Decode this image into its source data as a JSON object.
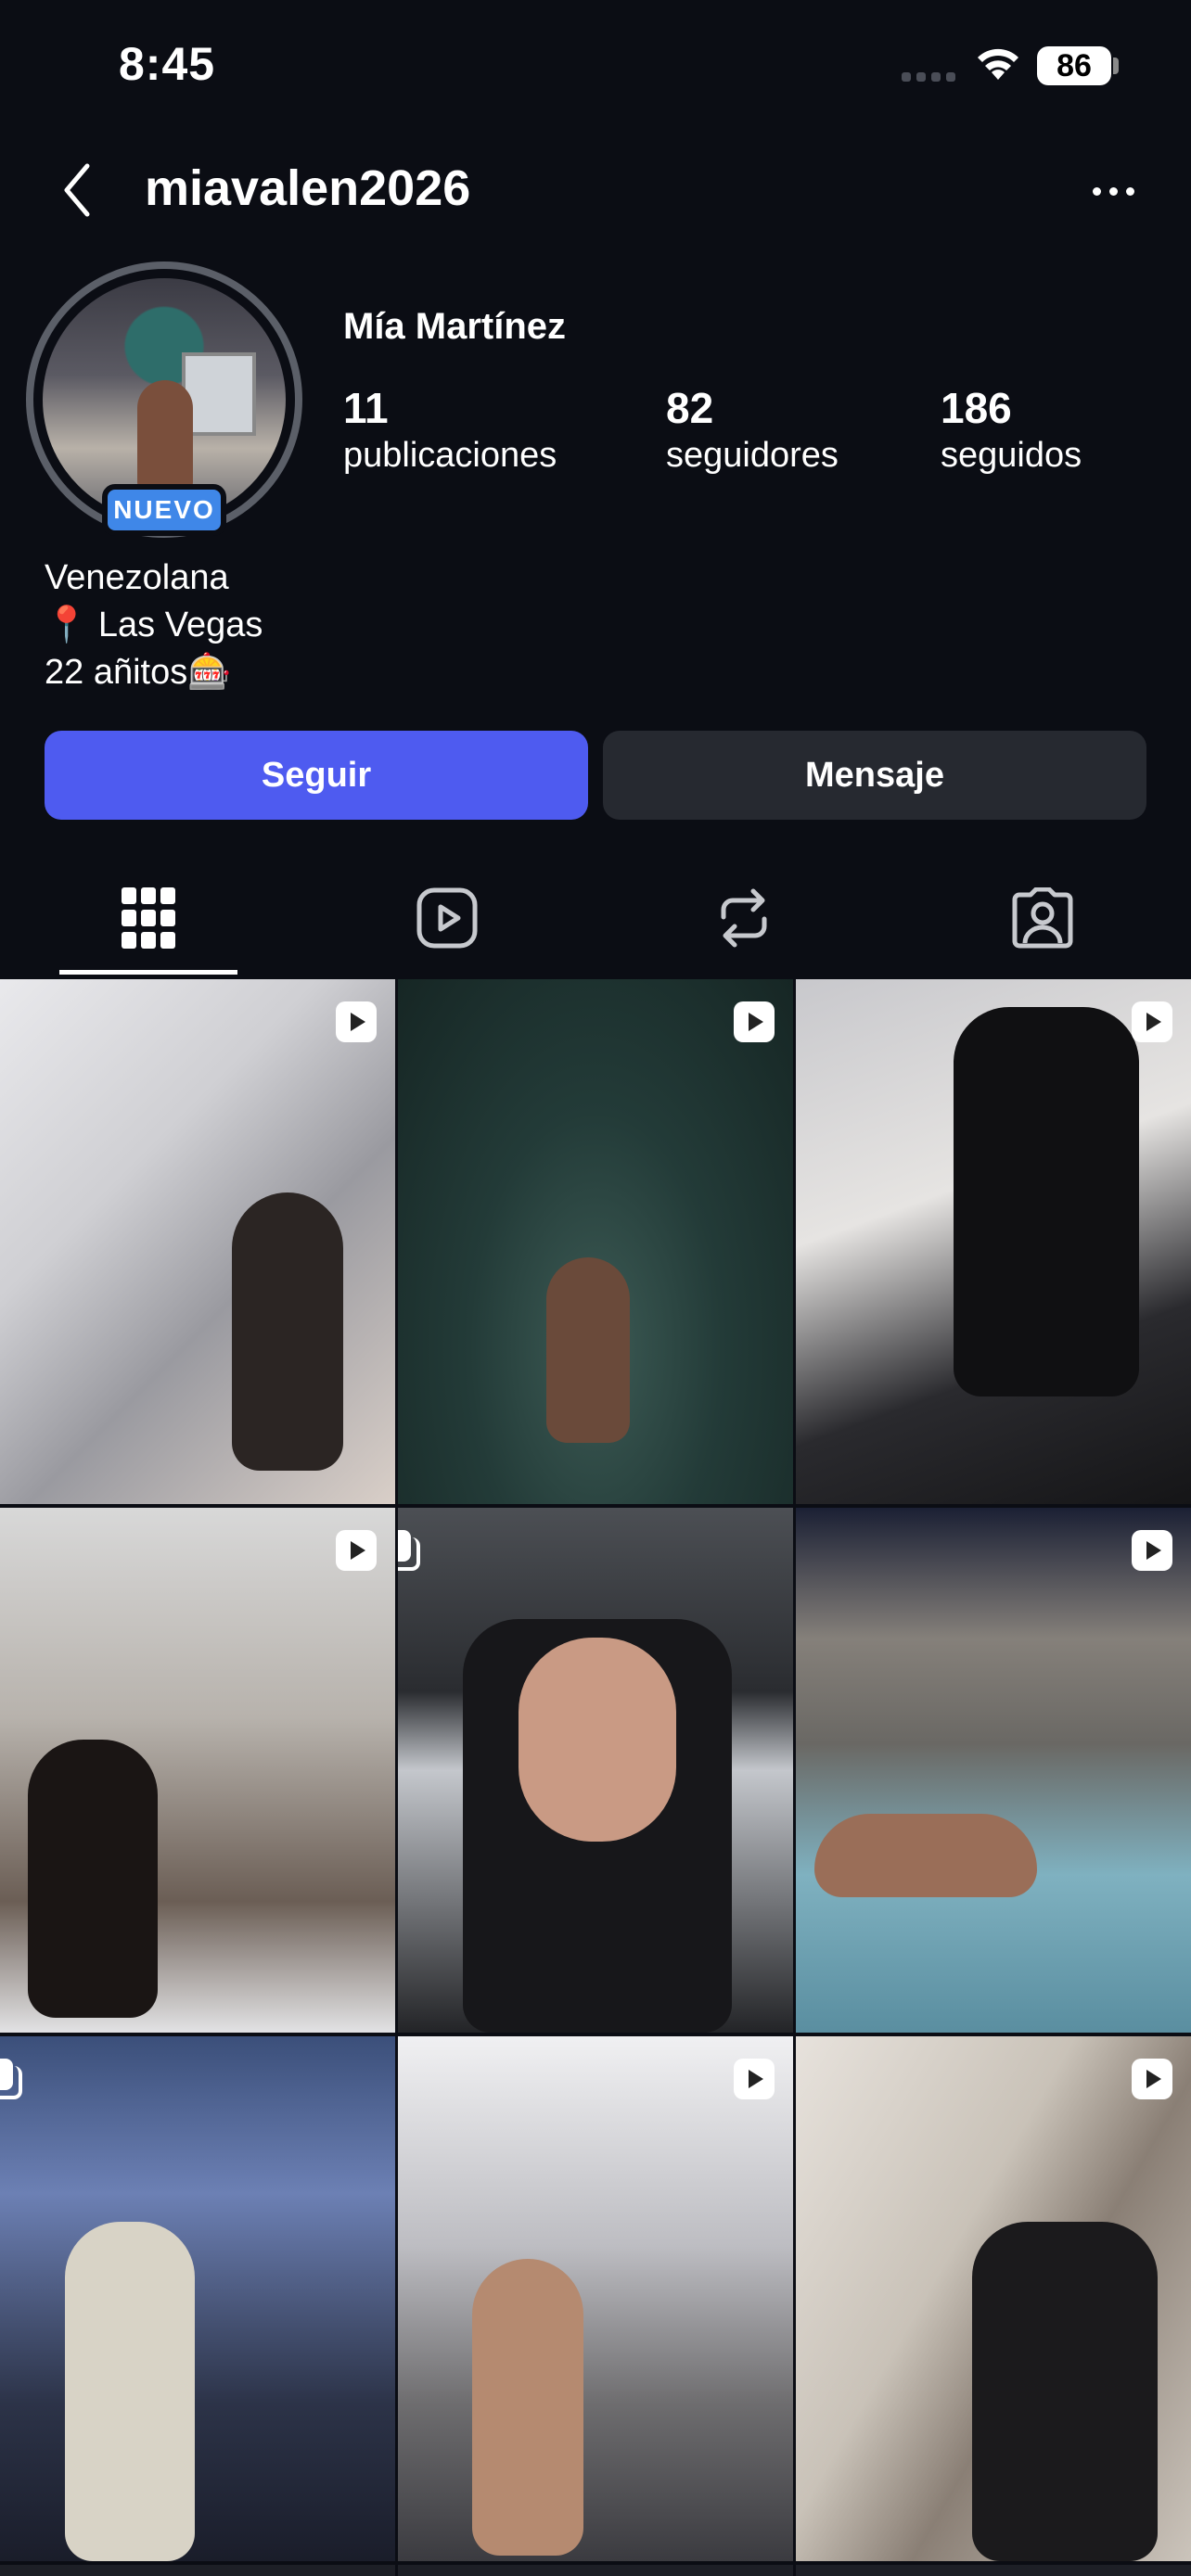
{
  "status_bar": {
    "time": "8:45",
    "battery": "86"
  },
  "header": {
    "username": "miavalen2026",
    "back_icon": "chevron-left-icon",
    "more_icon": "ellipsis-icon"
  },
  "profile": {
    "full_name": "Mía Martínez",
    "badge": "NUEVO",
    "stats": [
      {
        "value": "11",
        "label": "publicaciones"
      },
      {
        "value": "82",
        "label": "seguidores"
      },
      {
        "value": "186",
        "label": "seguidos"
      }
    ],
    "bio": [
      "Venezolana",
      "📍 Las Vegas",
      "22 añitos🎰"
    ]
  },
  "actions": {
    "follow": "Seguir",
    "message": "Mensaje"
  },
  "colors": {
    "background": "#0b0d14",
    "follow_button": "#4e5bf0",
    "message_button": "#262930",
    "badge": "#3f87e8"
  },
  "tabs": [
    {
      "icon": "grid-icon",
      "selected": true
    },
    {
      "icon": "reels-icon",
      "selected": false
    },
    {
      "icon": "reposts-icon",
      "selected": false
    },
    {
      "icon": "tagged-icon",
      "selected": false
    }
  ],
  "posts": [
    {
      "type": "reel"
    },
    {
      "type": "reel"
    },
    {
      "type": "reel"
    },
    {
      "type": "reel"
    },
    {
      "type": "carousel"
    },
    {
      "type": "reel"
    },
    {
      "type": "carousel"
    },
    {
      "type": "reel"
    },
    {
      "type": "reel"
    }
  ]
}
